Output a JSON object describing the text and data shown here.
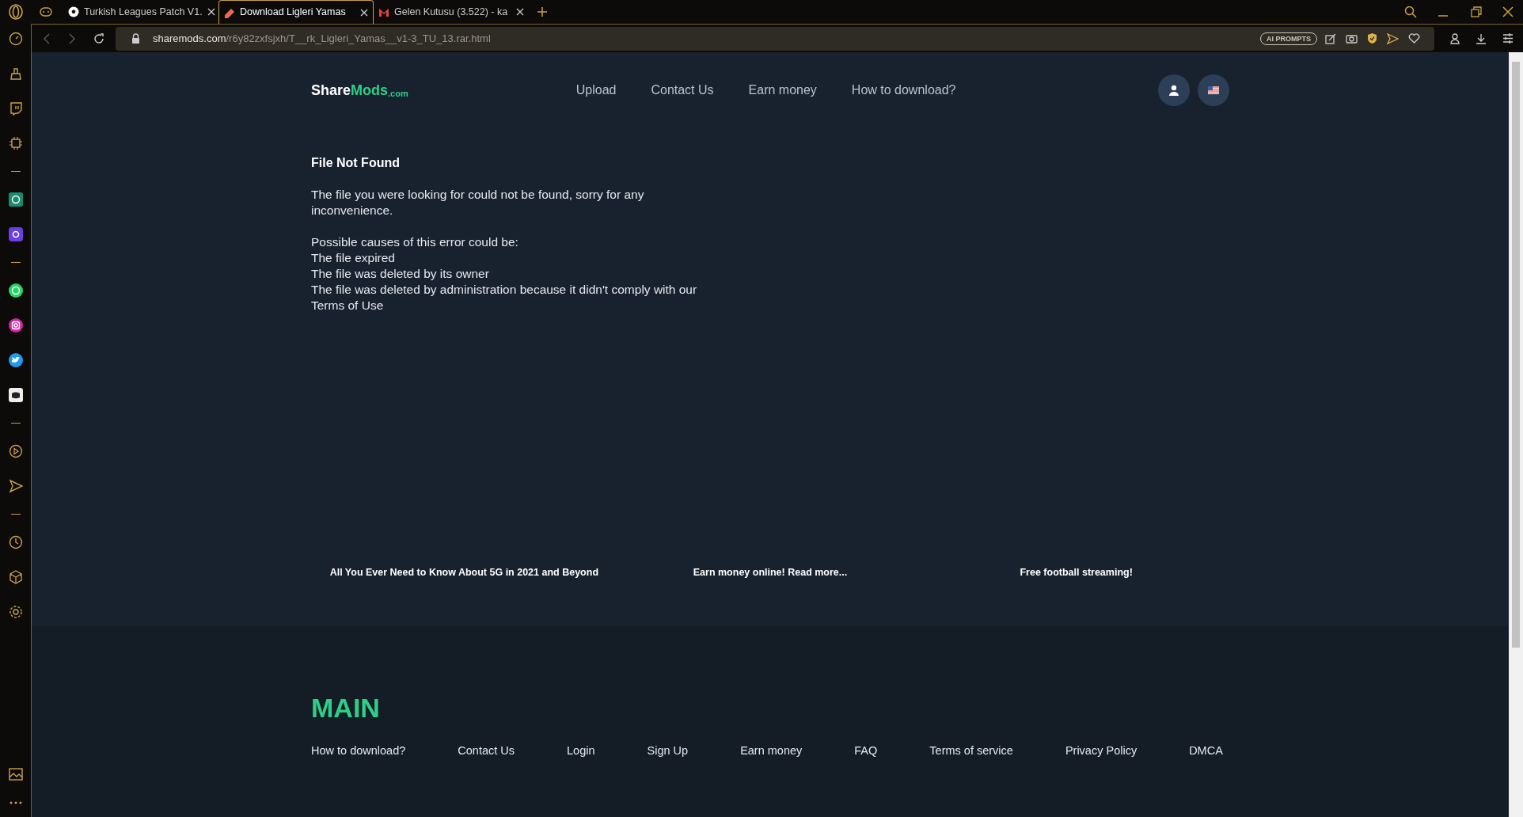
{
  "browser": {
    "tabs": [
      {
        "title": "Turkish Leagues Patch V1.",
        "selected": false,
        "kind": "ball"
      },
      {
        "title": "Download Ligleri Yamas",
        "selected": true,
        "kind": "mods"
      },
      {
        "title": "Gelen Kutusu (3.522) - ka",
        "selected": false,
        "kind": "mail"
      }
    ],
    "address": {
      "host": "sharemods.com",
      "path": "/r6y82zxfsjxh/T__rk_Ligleri_Yamas__v1-3_TU_13.rar.html"
    },
    "ai_prompts": "AI PROMPTS"
  },
  "header": {
    "logo": {
      "main": "Share",
      "accent": "Mods",
      "suffix": ".com"
    },
    "nav": [
      "Upload",
      "Contact Us",
      "Earn money",
      "How to download?"
    ]
  },
  "content": {
    "title": "File Not Found",
    "message": "The file you were looking for could not be found, sorry for any inconvenience.",
    "causes_title": "Possible causes of this error could be:",
    "causes": [
      "The file expired",
      "The file was deleted by its owner",
      "The file was deleted by administration because it didn't comply with our Terms of Use"
    ]
  },
  "promo_links": [
    "All You Ever Need to Know About 5G in 2021 and Beyond",
    "Earn money online! Read more...",
    "Free football streaming!"
  ],
  "footer": {
    "heading": "MAIN",
    "links": [
      "How to download?",
      "Contact Us",
      "Login",
      "Sign Up",
      "Earn money",
      "FAQ",
      "Terms of service",
      "Privacy Policy",
      "DMCA"
    ]
  }
}
